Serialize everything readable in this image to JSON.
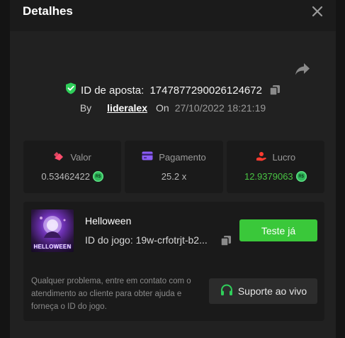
{
  "modal": {
    "title": "Detalhes",
    "close_icon": "close-icon",
    "share_icon": "share-icon"
  },
  "bet": {
    "id_label": "ID de aposta:",
    "id_value": "174787729002612467​2",
    "by_label": "By",
    "username": "lideralex",
    "on_label": "On",
    "datetime": "27/10/2022 18:21:19"
  },
  "stats": {
    "valor": {
      "label": "Valor",
      "value": "0.53462422",
      "icon": "stake-icon",
      "color": "#ff4d6d"
    },
    "pagamento": {
      "label": "Pagamento",
      "value": "25.2 x",
      "icon": "card-icon",
      "color": "#8b5cf6"
    },
    "lucro": {
      "label": "Lucro",
      "value": "12.9379063",
      "icon": "profit-icon",
      "color": "#ff3b30",
      "value_color": "#49c443"
    },
    "currency": "R$"
  },
  "game": {
    "name": "Helloween",
    "thumb_text": "HELLOWEEN",
    "id_label": "ID do jogo: 19w-crfotrjt-b2...",
    "play_label": "Teste já",
    "help_text": "Qualquer problema, entre em contato com o atendimento ao cliente para obter ajuda e forneça o ID do jogo.",
    "support_label": "Suporte ao vivo",
    "support_icon": "headset-icon"
  },
  "colors": {
    "accent_green": "#3ac83a",
    "verified_green": "#2fcf5a",
    "panel": "#1a1a1a",
    "modal": "#212121"
  }
}
